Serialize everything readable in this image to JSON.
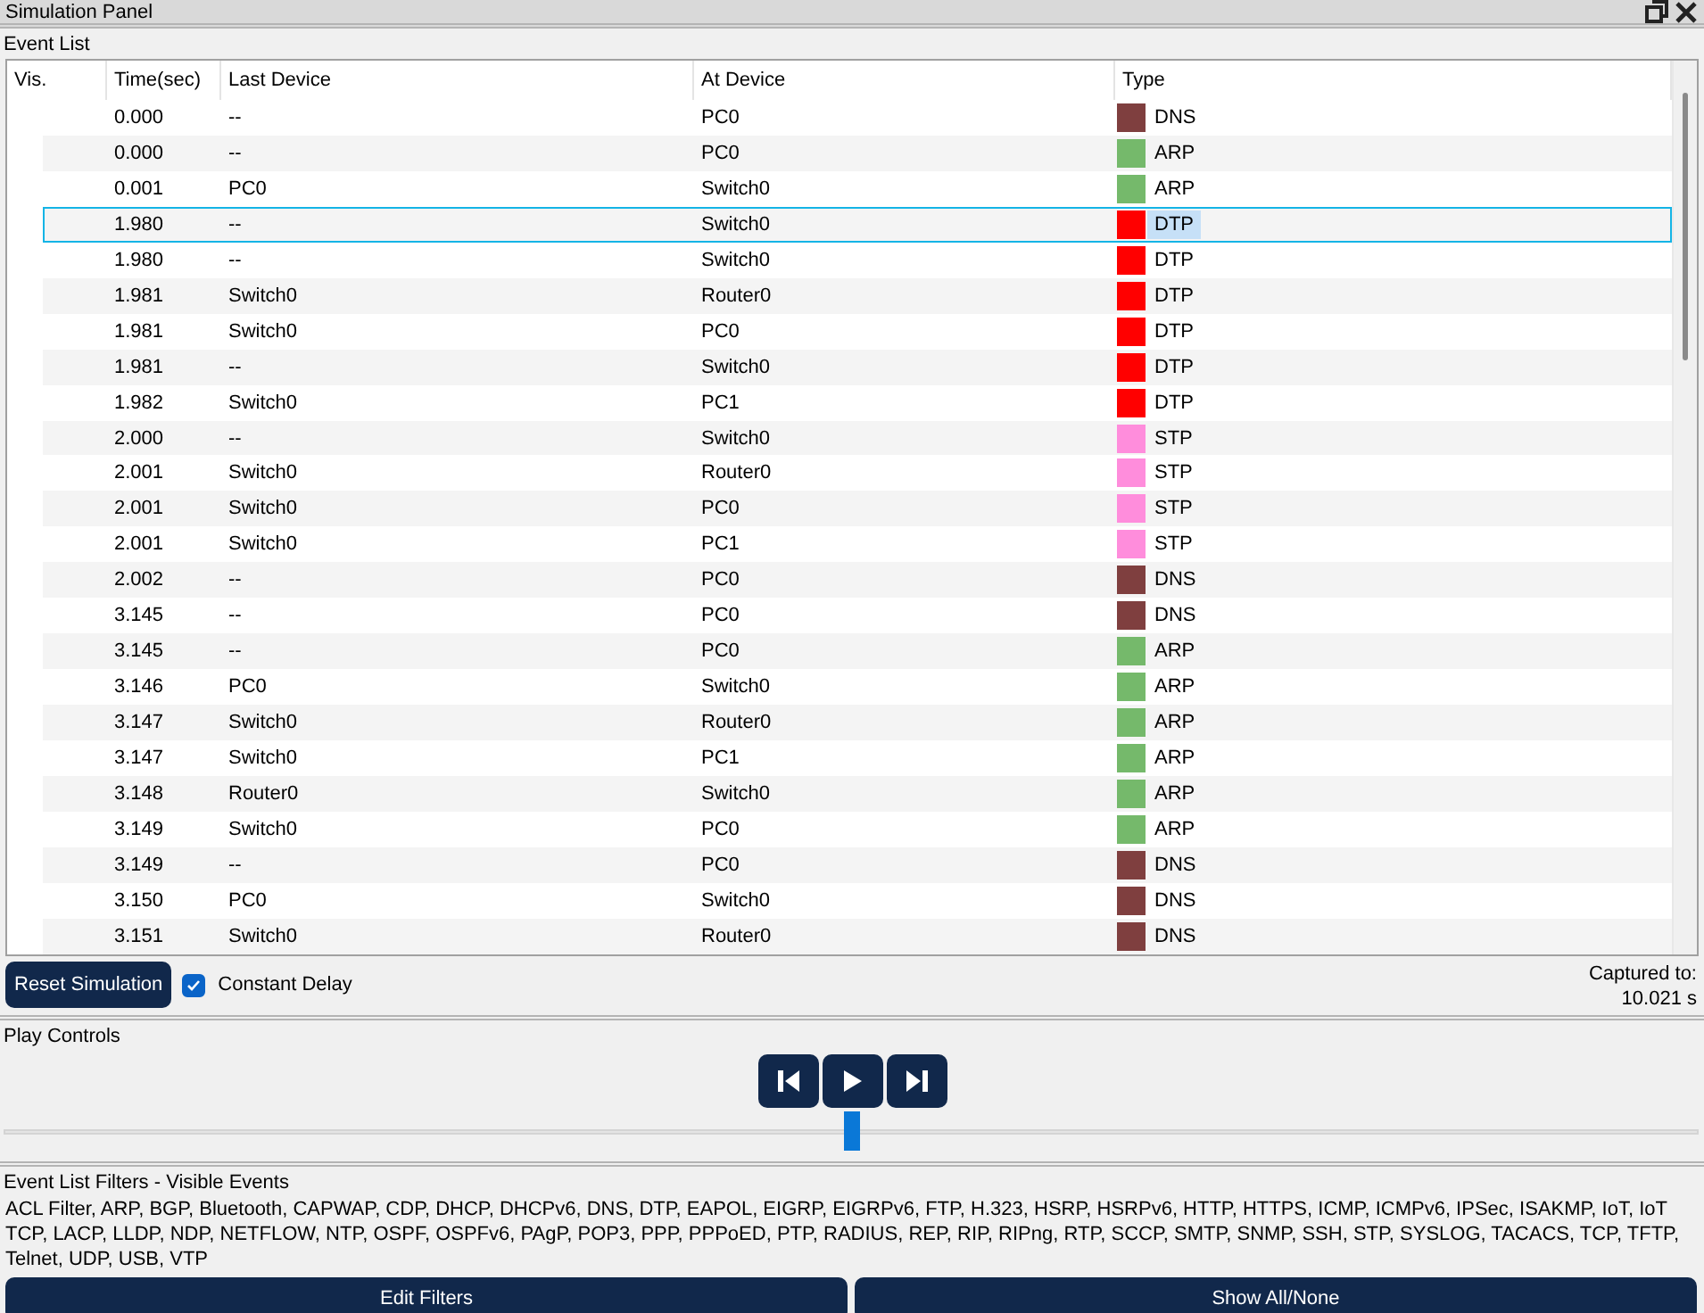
{
  "window": {
    "title": "Simulation Panel"
  },
  "event_list": {
    "title": "Event List",
    "columns": [
      "Vis.",
      "Time(sec)",
      "Last Device",
      "At Device",
      "Type"
    ],
    "rows": [
      {
        "time": "0.000",
        "last_device": "--",
        "at_device": "PC0",
        "type": "DNS",
        "color": "#7f3f3f",
        "selected": false
      },
      {
        "time": "0.000",
        "last_device": "--",
        "at_device": "PC0",
        "type": "ARP",
        "color": "#75b96b",
        "selected": false
      },
      {
        "time": "0.001",
        "last_device": "PC0",
        "at_device": "Switch0",
        "type": "ARP",
        "color": "#75b96b",
        "selected": false
      },
      {
        "time": "1.980",
        "last_device": "--",
        "at_device": "Switch0",
        "type": "DTP",
        "color": "#ff0000",
        "selected": true
      },
      {
        "time": "1.980",
        "last_device": "--",
        "at_device": "Switch0",
        "type": "DTP",
        "color": "#ff0000",
        "selected": false
      },
      {
        "time": "1.981",
        "last_device": "Switch0",
        "at_device": "Router0",
        "type": "DTP",
        "color": "#ff0000",
        "selected": false
      },
      {
        "time": "1.981",
        "last_device": "Switch0",
        "at_device": "PC0",
        "type": "DTP",
        "color": "#ff0000",
        "selected": false
      },
      {
        "time": "1.981",
        "last_device": "--",
        "at_device": "Switch0",
        "type": "DTP",
        "color": "#ff0000",
        "selected": false
      },
      {
        "time": "1.982",
        "last_device": "Switch0",
        "at_device": "PC1",
        "type": "DTP",
        "color": "#ff0000",
        "selected": false
      },
      {
        "time": "2.000",
        "last_device": "--",
        "at_device": "Switch0",
        "type": "STP",
        "color": "#ff8ddc",
        "selected": false
      },
      {
        "time": "2.001",
        "last_device": "Switch0",
        "at_device": "Router0",
        "type": "STP",
        "color": "#ff8ddc",
        "selected": false
      },
      {
        "time": "2.001",
        "last_device": "Switch0",
        "at_device": "PC0",
        "type": "STP",
        "color": "#ff8ddc",
        "selected": false
      },
      {
        "time": "2.001",
        "last_device": "Switch0",
        "at_device": "PC1",
        "type": "STP",
        "color": "#ff8ddc",
        "selected": false
      },
      {
        "time": "2.002",
        "last_device": "--",
        "at_device": "PC0",
        "type": "DNS",
        "color": "#7f3f3f",
        "selected": false
      },
      {
        "time": "3.145",
        "last_device": "--",
        "at_device": "PC0",
        "type": "DNS",
        "color": "#7f3f3f",
        "selected": false
      },
      {
        "time": "3.145",
        "last_device": "--",
        "at_device": "PC0",
        "type": "ARP",
        "color": "#75b96b",
        "selected": false
      },
      {
        "time": "3.146",
        "last_device": "PC0",
        "at_device": "Switch0",
        "type": "ARP",
        "color": "#75b96b",
        "selected": false
      },
      {
        "time": "3.147",
        "last_device": "Switch0",
        "at_device": "Router0",
        "type": "ARP",
        "color": "#75b96b",
        "selected": false
      },
      {
        "time": "3.147",
        "last_device": "Switch0",
        "at_device": "PC1",
        "type": "ARP",
        "color": "#75b96b",
        "selected": false
      },
      {
        "time": "3.148",
        "last_device": "Router0",
        "at_device": "Switch0",
        "type": "ARP",
        "color": "#75b96b",
        "selected": false
      },
      {
        "time": "3.149",
        "last_device": "Switch0",
        "at_device": "PC0",
        "type": "ARP",
        "color": "#75b96b",
        "selected": false
      },
      {
        "time": "3.149",
        "last_device": "--",
        "at_device": "PC0",
        "type": "DNS",
        "color": "#7f3f3f",
        "selected": false
      },
      {
        "time": "3.150",
        "last_device": "PC0",
        "at_device": "Switch0",
        "type": "DNS",
        "color": "#7f3f3f",
        "selected": false
      },
      {
        "time": "3.151",
        "last_device": "Switch0",
        "at_device": "Router0",
        "type": "DNS",
        "color": "#7f3f3f",
        "selected": false
      }
    ]
  },
  "reset_button": "Reset Simulation",
  "constant_delay": {
    "label": "Constant Delay",
    "checked": true
  },
  "captured": {
    "label": "Captured to:",
    "value": "10.021 s"
  },
  "play_controls": {
    "title": "Play Controls",
    "level": 0.5
  },
  "filters": {
    "title": "Event List Filters - Visible Events",
    "list": "ACL Filter, ARP, BGP, Bluetooth, CAPWAP, CDP, DHCP, DHCPv6, DNS, DTP, EAPOL, EIGRP, EIGRPv6, FTP, H.323, HSRP, HSRPv6, HTTP, HTTPS, ICMP, ICMPv6, IPSec, ISAKMP, IoT, IoT TCP, LACP, LLDP, NDP, NETFLOW, NTP, OSPF, OSPFv6, PAgP, POP3, PPP, PPPoED, PTP, RADIUS, REP, RIP, RIPng, RTP, SCCP, SMTP, SNMP, SSH, STP, SYSLOG, TACACS, TCP, TFTP, Telnet, UDP, USB, VTP",
    "buttons": [
      "Edit Filters",
      "Show All/None"
    ]
  }
}
